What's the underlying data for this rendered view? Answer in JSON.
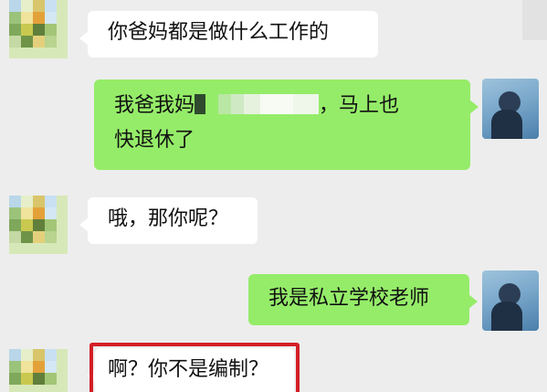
{
  "chat": {
    "messages": [
      {
        "side": "left",
        "text": "你爸妈都是做什么工作的"
      },
      {
        "side": "right",
        "line1_prefix": "我爸我妈",
        "line1_suffix": "，马上也",
        "line2": "快退休了"
      },
      {
        "side": "left",
        "text": "哦，那你呢？"
      },
      {
        "side": "right",
        "text": "我是私立学校老师"
      },
      {
        "side": "left",
        "text": "啊？你不是编制？"
      }
    ]
  },
  "colors": {
    "background": "#ededed",
    "incoming_bubble": "#ffffff",
    "outgoing_bubble": "#95ec69",
    "highlight": "#d41f26"
  },
  "icons": {
    "left_avatar": "mosaic-avatar-icon",
    "right_avatar": "photo-avatar-icon",
    "redaction": "mosaic-redaction-icon"
  }
}
